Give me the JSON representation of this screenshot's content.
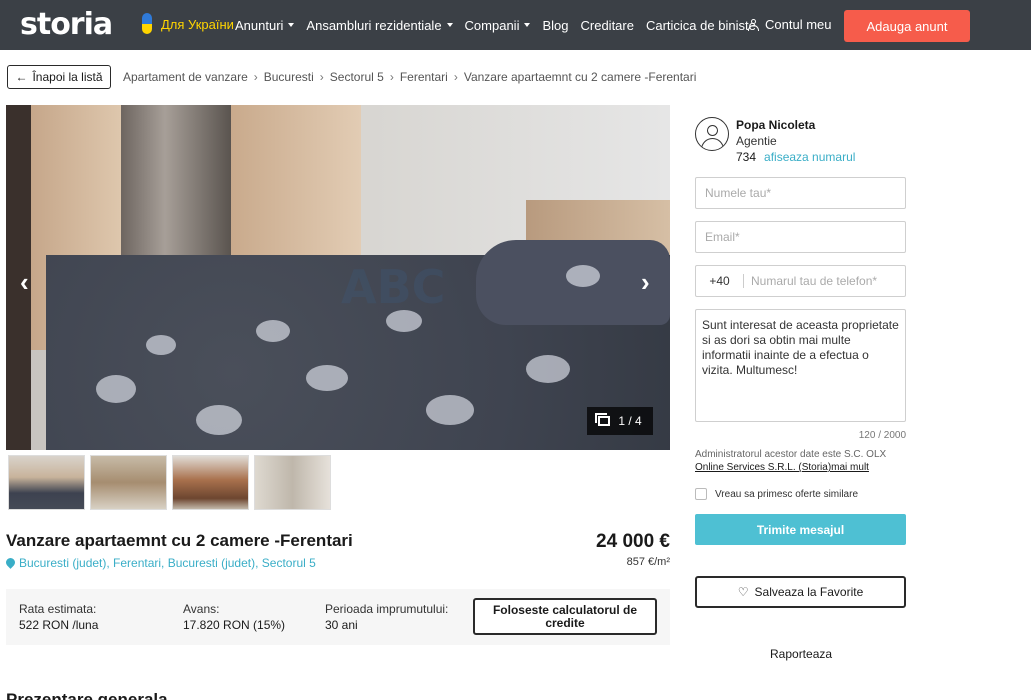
{
  "header": {
    "logo": "storia",
    "ukraine_label": "Для України",
    "nav": [
      {
        "label": "Anunturi",
        "dropdown": true
      },
      {
        "label": "Ansambluri rezidentiale",
        "dropdown": true
      },
      {
        "label": "Companii",
        "dropdown": true
      },
      {
        "label": "Blog",
        "dropdown": false
      },
      {
        "label": "Creditare",
        "dropdown": false
      },
      {
        "label": "Carticica de biniste",
        "dropdown": false
      }
    ],
    "account_label": "Contul meu",
    "add_button": "Adauga anunt",
    "colors": {
      "bar": "#3b4046",
      "accent": "#f65c4b",
      "ukraine_yellow": "#ffd500"
    }
  },
  "breadcrumb": {
    "back_label": "Înapoi la listă",
    "items": [
      "Apartament de vanzare",
      "Bucuresti",
      "Sectorul 5",
      "Ferentari",
      "Vanzare apartaemnt cu 2 camere -Ferentari"
    ]
  },
  "gallery": {
    "counter": "1 / 4",
    "watermark": "ABC",
    "prev_icon": "chevron-left-icon",
    "next_icon": "chevron-right-icon",
    "thumbnails": 4
  },
  "listing": {
    "title": "Vanzare apartaemnt cu 2 camere -Ferentari",
    "location": "Bucuresti (judet), Ferentari, Bucuresti (judet), Sectorul 5",
    "price": "24 000 €",
    "price_per_sqm": "857 €/m²"
  },
  "credit": {
    "rate_label": "Rata estimata:",
    "rate_value": "522 RON /luna",
    "advance_label": "Avans:",
    "advance_value": "17.820 RON (15%)",
    "period_label": "Perioada imprumutului:",
    "period_value": "30 ani",
    "calc_button": "Foloseste calculatorul de credite"
  },
  "next_section": "Prezentare generala",
  "agent": {
    "name": "Popa Nicoleta",
    "role": "Agentie",
    "phone_partial": "734",
    "show_number": "afiseaza numarul"
  },
  "form": {
    "name_placeholder": "Numele tau*",
    "email_placeholder": "Email*",
    "phone_prefix": "+40",
    "phone_placeholder": "Numarul tau de telefon*",
    "message": "Sunt interesat de aceasta proprietate si as dori sa obtin mai multe informatii inainte de a efectua o vizita. Multumesc!",
    "char_count": "120 / 2000",
    "admin_text": "Administratorul acestor date este S.C. OLX",
    "admin_link": "Online Services S.R.L. (Storia)mai mult",
    "similar_offers_label": "Vreau sa primesc oferte similare",
    "send_button": "Trimite mesajul",
    "favorite_button": "Salveaza la Favorite",
    "report_link": "Raporteaza",
    "send_color": "#4ec0d3"
  }
}
